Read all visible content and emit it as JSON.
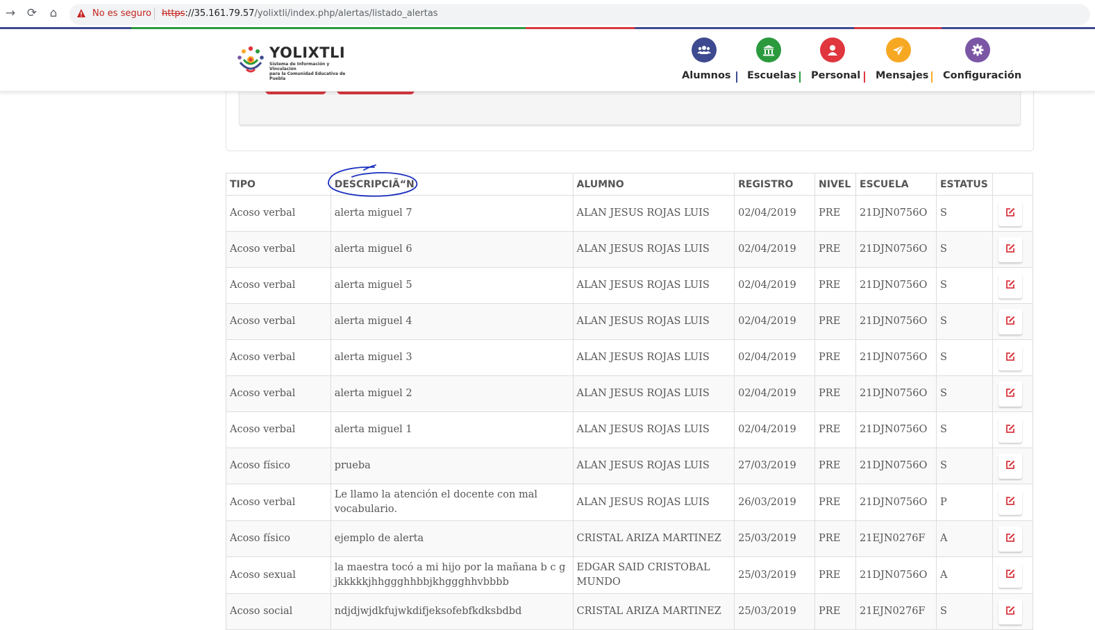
{
  "browser": {
    "security_label": "No es seguro",
    "url_scheme": "https",
    "url_host": "://35.161.79.57",
    "url_path": "/yolixtli/index.php/alertas/listado_alertas"
  },
  "brand": {
    "title": "YOLIXTLI",
    "subtitle_line1": "Sistema de Información y Vinculación",
    "subtitle_line2": "para la Comunidad Educativa de Puebla"
  },
  "nav": [
    {
      "label": "Alumnos",
      "color": "#3d4a8f",
      "icon": "users-icon"
    },
    {
      "label": "Escuelas",
      "color": "#2b9a3d",
      "icon": "school-building-icon"
    },
    {
      "label": "Personal",
      "color": "#e0363e",
      "icon": "person-icon"
    },
    {
      "label": "Mensajes",
      "color": "#f7a823",
      "icon": "paper-plane-icon"
    },
    {
      "label": "Configuración",
      "color": "#7a56a5",
      "icon": "gear-icon"
    }
  ],
  "table": {
    "headers": [
      "TIPO",
      "DESCRIPCIÃ“N",
      "ALUMNO",
      "REGISTRO",
      "NIVEL",
      "ESCUELA",
      "ESTATUS",
      ""
    ],
    "rows": [
      [
        "Acoso verbal",
        "alerta miguel 7",
        "ALAN JESUS ROJAS LUIS",
        "02/04/2019",
        "PRE",
        "21DJN0756O",
        "S"
      ],
      [
        "Acoso verbal",
        "alerta miguel 6",
        "ALAN JESUS ROJAS LUIS",
        "02/04/2019",
        "PRE",
        "21DJN0756O",
        "S"
      ],
      [
        "Acoso verbal",
        "alerta miguel 5",
        "ALAN JESUS ROJAS LUIS",
        "02/04/2019",
        "PRE",
        "21DJN0756O",
        "S"
      ],
      [
        "Acoso verbal",
        "alerta miguel 4",
        "ALAN JESUS ROJAS LUIS",
        "02/04/2019",
        "PRE",
        "21DJN0756O",
        "S"
      ],
      [
        "Acoso verbal",
        "alerta miguel 3",
        "ALAN JESUS ROJAS LUIS",
        "02/04/2019",
        "PRE",
        "21DJN0756O",
        "S"
      ],
      [
        "Acoso verbal",
        "alerta miguel 2",
        "ALAN JESUS ROJAS LUIS",
        "02/04/2019",
        "PRE",
        "21DJN0756O",
        "S"
      ],
      [
        "Acoso verbal",
        "alerta miguel 1",
        "ALAN JESUS ROJAS LUIS",
        "02/04/2019",
        "PRE",
        "21DJN0756O",
        "S"
      ],
      [
        "Acoso físico",
        "prueba",
        "ALAN JESUS ROJAS LUIS",
        "27/03/2019",
        "PRE",
        "21DJN0756O",
        "S"
      ],
      [
        "Acoso verbal",
        "Le llamo la atención el docente con mal vocabulario.",
        "ALAN JESUS ROJAS LUIS",
        "26/03/2019",
        "PRE",
        "21DJN0756O",
        "P"
      ],
      [
        "Acoso físico",
        "ejemplo de alerta",
        "CRISTAL ARIZA MARTINEZ",
        "25/03/2019",
        "PRE",
        "21EJN0276F",
        "A"
      ],
      [
        "Acoso sexual",
        "la maestra tocó a mi hijo por la mañana b c g jkkkkkjhhggghhbbjkhggghhvbbbb",
        "EDGAR SAID CRISTOBAL MUNDO",
        "25/03/2019",
        "PRE",
        "21DJN0756O",
        "A"
      ],
      [
        "Acoso social",
        "ndjdjwjdkfujwkdifjeksofebfkdksbdbd",
        "CRISTAL ARIZA MARTINEZ",
        "25/03/2019",
        "PRE",
        "21EJN0276F",
        "S"
      ]
    ],
    "edit_icon": "edit-square-icon",
    "edit_icon_color": "#d9363e"
  },
  "annotation": {
    "type": "hand-drawn-circle",
    "color": "#1a2fbf"
  }
}
